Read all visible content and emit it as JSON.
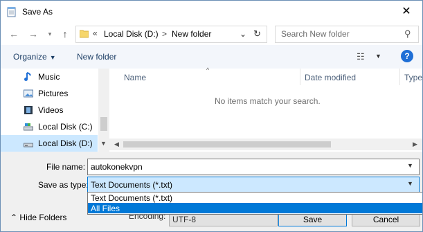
{
  "window": {
    "title": "Save As"
  },
  "nav": {
    "address": {
      "chevron": "«",
      "crumbs": [
        "Local Disk (D:)",
        "New folder"
      ],
      "separator": ">"
    },
    "search_placeholder": "Search New folder"
  },
  "toolbar": {
    "organize_label": "Organize",
    "new_folder_label": "New folder"
  },
  "sidebar": {
    "items": [
      {
        "label": "Music",
        "icon": "music-icon"
      },
      {
        "label": "Pictures",
        "icon": "pictures-icon"
      },
      {
        "label": "Videos",
        "icon": "videos-icon"
      },
      {
        "label": "Local Disk (C:)",
        "icon": "drive-icon"
      },
      {
        "label": "Local Disk (D:)",
        "icon": "drive-icon",
        "selected": true
      }
    ]
  },
  "file_list": {
    "columns": [
      "Name",
      "Date modified",
      "Type"
    ],
    "empty_message": "No items match your search."
  },
  "form": {
    "filename_label": "File name:",
    "filename_value": "autokonekvpn",
    "type_label": "Save as type:",
    "type_value": "Text Documents (*.txt)",
    "type_options": [
      "Text Documents (*.txt)",
      "All Files"
    ],
    "highlighted_option": "All Files",
    "encoding_label": "Encoding:",
    "encoding_value": "UTF-8"
  },
  "footer": {
    "hide_folders_label": "Hide Folders",
    "save_label": "Save",
    "cancel_label": "Cancel"
  },
  "colors": {
    "accent": "#0078d7",
    "selection": "#cce8ff",
    "link": "#1e3f66"
  }
}
